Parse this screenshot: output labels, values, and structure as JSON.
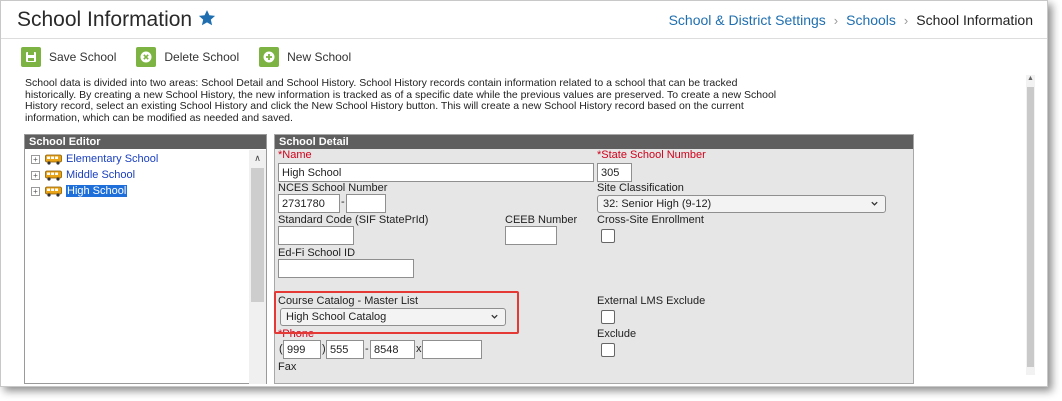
{
  "header": {
    "title": "School Information",
    "breadcrumbs": [
      "School & District Settings",
      "Schools",
      "School Information"
    ]
  },
  "toolbar": {
    "save_label": "Save School",
    "delete_label": "Delete School",
    "new_label": "New School"
  },
  "description": "School data is divided into two areas: School Detail and School History. School History records contain information related to a school that can be tracked historically. By creating a new School History, the new information is tracked as of a specific date while the previous values are preserved. To create a new School History record, select an existing School History and click the New School History button. This will create a new School History record based on the current information, which can be modified as needed and saved.",
  "editor": {
    "title": "School Editor",
    "items": [
      {
        "label": "Elementary School",
        "selected": false
      },
      {
        "label": "Middle School",
        "selected": false
      },
      {
        "label": "High School",
        "selected": true
      }
    ]
  },
  "detail": {
    "title": "School Detail",
    "name_label": "Name",
    "name_value": "High School",
    "state_number_label": "State School Number",
    "state_number_value": "305",
    "nces_label": "NCES School Number",
    "nces_value_1": "2731780",
    "nces_value_2": "",
    "site_class_label": "Site Classification",
    "site_class_value": "32: Senior High (9-12)",
    "standard_code_label": "Standard Code (SIF StatePrId)",
    "standard_code_value": "",
    "ceeb_label": "CEEB Number",
    "ceeb_value": "",
    "cross_site_label": "Cross-Site Enrollment",
    "edfi_label": "Ed-Fi School ID",
    "edfi_value": "",
    "catalog_label": "Course Catalog - Master List",
    "catalog_value": "High School Catalog",
    "lms_label": "External LMS Exclude",
    "phone_label": "Phone",
    "phone_area": "999",
    "phone_prefix": "555",
    "phone_line": "8548",
    "phone_ext_sep": "x",
    "phone_ext": "",
    "exclude_label": "Exclude",
    "fax_label": "Fax"
  },
  "colors": {
    "accent": "#1f6fb0",
    "toolbar_icon": "#7cb342",
    "panel_header": "#5f5f5f",
    "required": "#d0021b",
    "highlight": "#e53935"
  }
}
